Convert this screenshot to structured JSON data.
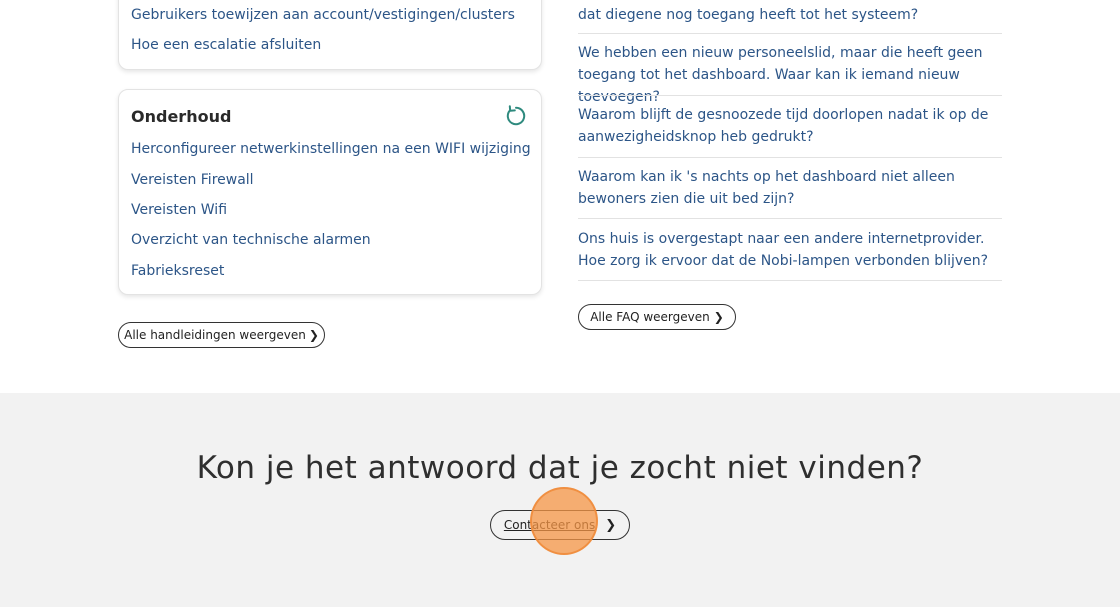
{
  "guides": {
    "top_links": [
      "Gebruikers toewijzen aan account/vestigingen/clusters",
      "Hoe een escalatie afsluiten"
    ],
    "maintenance": {
      "title": "Onderhoud",
      "icon": "refresh-icon",
      "links": [
        "Herconfigureer netwerkinstellingen na een WIFI wijziging",
        "Vereisten Firewall",
        "Vereisten Wifi",
        "Overzicht van technische alarmen",
        "Fabrieksreset"
      ]
    },
    "view_all_label": "Alle handleidingen weergeven"
  },
  "faq": {
    "items": [
      "dat diegene nog toegang heeft tot het systeem?",
      "We hebben een nieuw personeelslid, maar die heeft geen toegang tot het dashboard. Waar kan ik iemand nieuw toevoegen?",
      "Waarom blijft de gesnoozede tijd doorlopen nadat ik op de aanwezigheidsknop heb gedrukt?",
      "Waarom kan ik 's nachts op het dashboard niet alleen bewoners zien die uit bed zijn?",
      "Ons huis is overgestapt naar een andere internetprovider. Hoe zorg ik ervoor dat de Nobi-lampen verbonden blijven?"
    ],
    "view_all_label": "Alle FAQ weergeven"
  },
  "contact": {
    "title": "Kon je het antwoord dat je zocht niet vinden?",
    "button_label": "Contacteer ons"
  },
  "colors": {
    "link": "#2c5587",
    "accent": "#2e8a7e",
    "footer_bg": "#f2f2f2",
    "click_marker": "#f5964a"
  }
}
